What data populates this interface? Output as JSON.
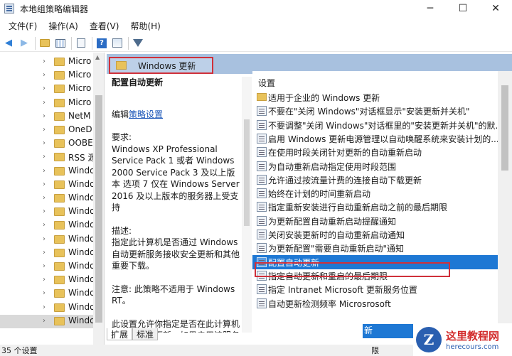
{
  "window": {
    "title": "本地组策略编辑器",
    "minimize": "─",
    "maximize": "☐",
    "close": "✕"
  },
  "menu": [
    "文件(F)",
    "操作(A)",
    "查看(V)",
    "帮助(H)"
  ],
  "toolbar_icons": [
    "back-arrow-icon",
    "forward-arrow-icon",
    "up-folder-icon",
    "show-hide-tree-icon",
    "export-list-icon",
    "help-icon",
    "properties-icon",
    "filter-icon"
  ],
  "tree": {
    "items": [
      "Micro",
      "Micro",
      "Micro",
      "Micro",
      "NetM",
      "OneD",
      "OOBE",
      "RSS 源",
      "Windo",
      "Windo",
      "Windo",
      "Windo",
      "Windo",
      "Windo",
      "Windo",
      "Windo",
      "Windo",
      "Windo",
      "Windo",
      "Windo"
    ]
  },
  "right_header": {
    "title": "Windows 更新"
  },
  "description": {
    "title": "配置自动更新",
    "edit_prefix": "编辑",
    "edit_link": "策略设置",
    "requirements_label": "要求:",
    "requirements": "Windows XP Professional Service Pack 1 或者 Windows 2000 Service Pack 3 及以上版本 选项 7 仅在 Windows Server 2016 及以上版本的服务器上受支持",
    "desc_label": "描述:",
    "desc": "指定此计算机是否通过 Windows 自动更新服务接收安全更新和其他重要下载。",
    "note": "注意: 此策略不适用于 Windows RT。",
    "more": "此设置允许你指定是否在此计算机上启用自动更新。如果启用该服务"
  },
  "list": {
    "header": "设置",
    "items": [
      {
        "label": "适用于企业的 Windows 更新",
        "type": "folder"
      },
      {
        "label": "不要在\"关闭 Windows\"对话框显示\"安装更新并关机\"",
        "type": "setting"
      },
      {
        "label": "不要调整\"关闭 Windows\"对话框里的\"安装更新并关机\"的默...",
        "type": "setting"
      },
      {
        "label": "启用 Windows 更新电源管理以自动唤醒系统来安装计划的...",
        "type": "setting"
      },
      {
        "label": "在使用时段关闭针对更新的自动重新启动",
        "type": "setting"
      },
      {
        "label": "为自动重新启动指定使用时段范围",
        "type": "setting"
      },
      {
        "label": "允许通过按流量计费的连接自动下载更新",
        "type": "setting"
      },
      {
        "label": "始终在计划的时间重新启动",
        "type": "setting"
      },
      {
        "label": "指定重新安装进行自动重新启动之前的最后期限",
        "type": "setting"
      },
      {
        "label": "为更新配置自动重新启动提醒通知",
        "type": "setting"
      },
      {
        "label": "关闭安装更新时的自动重新启动通知",
        "type": "setting"
      },
      {
        "label": "为更新配置\"需要自动重新启动\"通知",
        "type": "setting"
      },
      {
        "label": "配置自动更新",
        "type": "setting",
        "selected": true
      },
      {
        "label": "指定自动更新和重启的最后期限",
        "type": "setting"
      },
      {
        "label": "指定 Intranet Microsoft 更新服务位置",
        "type": "setting"
      },
      {
        "label": "自动更新检测频率        Microsrosoft",
        "type": "setting"
      }
    ]
  },
  "bottom_fragment": {
    "selected_text": "新",
    "status_fragment": "限"
  },
  "tabs": [
    "扩展",
    "标准"
  ],
  "status": "35 个设置",
  "watermark": {
    "title": "这里教程网",
    "url": "herecours.com"
  },
  "colors": {
    "header_bg": "#a8c1df",
    "selection": "#1e78d4",
    "highlight_box": "#d0303a"
  }
}
